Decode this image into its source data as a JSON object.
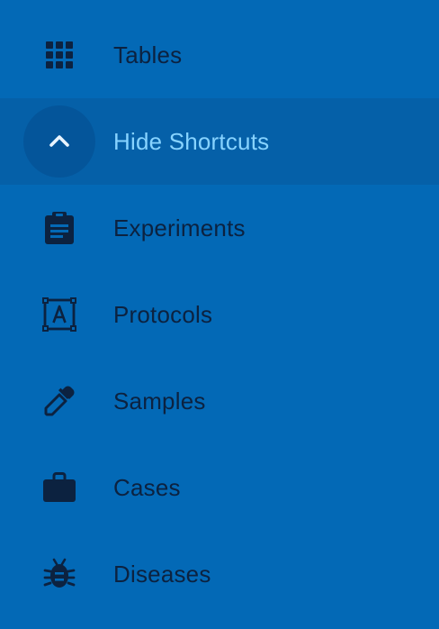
{
  "nav": {
    "items": [
      {
        "label": "Tables",
        "icon": "grid-icon",
        "active": false
      },
      {
        "label": "Hide Shortcuts",
        "icon": "chevron-up-icon",
        "active": true
      },
      {
        "label": "Experiments",
        "icon": "clipboard-icon",
        "active": false
      },
      {
        "label": "Protocols",
        "icon": "text-frame-icon",
        "active": false
      },
      {
        "label": "Samples",
        "icon": "eyedropper-icon",
        "active": false
      },
      {
        "label": "Cases",
        "icon": "briefcase-icon",
        "active": false
      },
      {
        "label": "Diseases",
        "icon": "bug-icon",
        "active": false
      }
    ]
  },
  "colors": {
    "background": "#0369b6",
    "active_row": "#0560a8",
    "active_circle": "#04559a",
    "text": "#0c2240",
    "active_text": "#87d3ff",
    "icon": "#0c2240"
  }
}
